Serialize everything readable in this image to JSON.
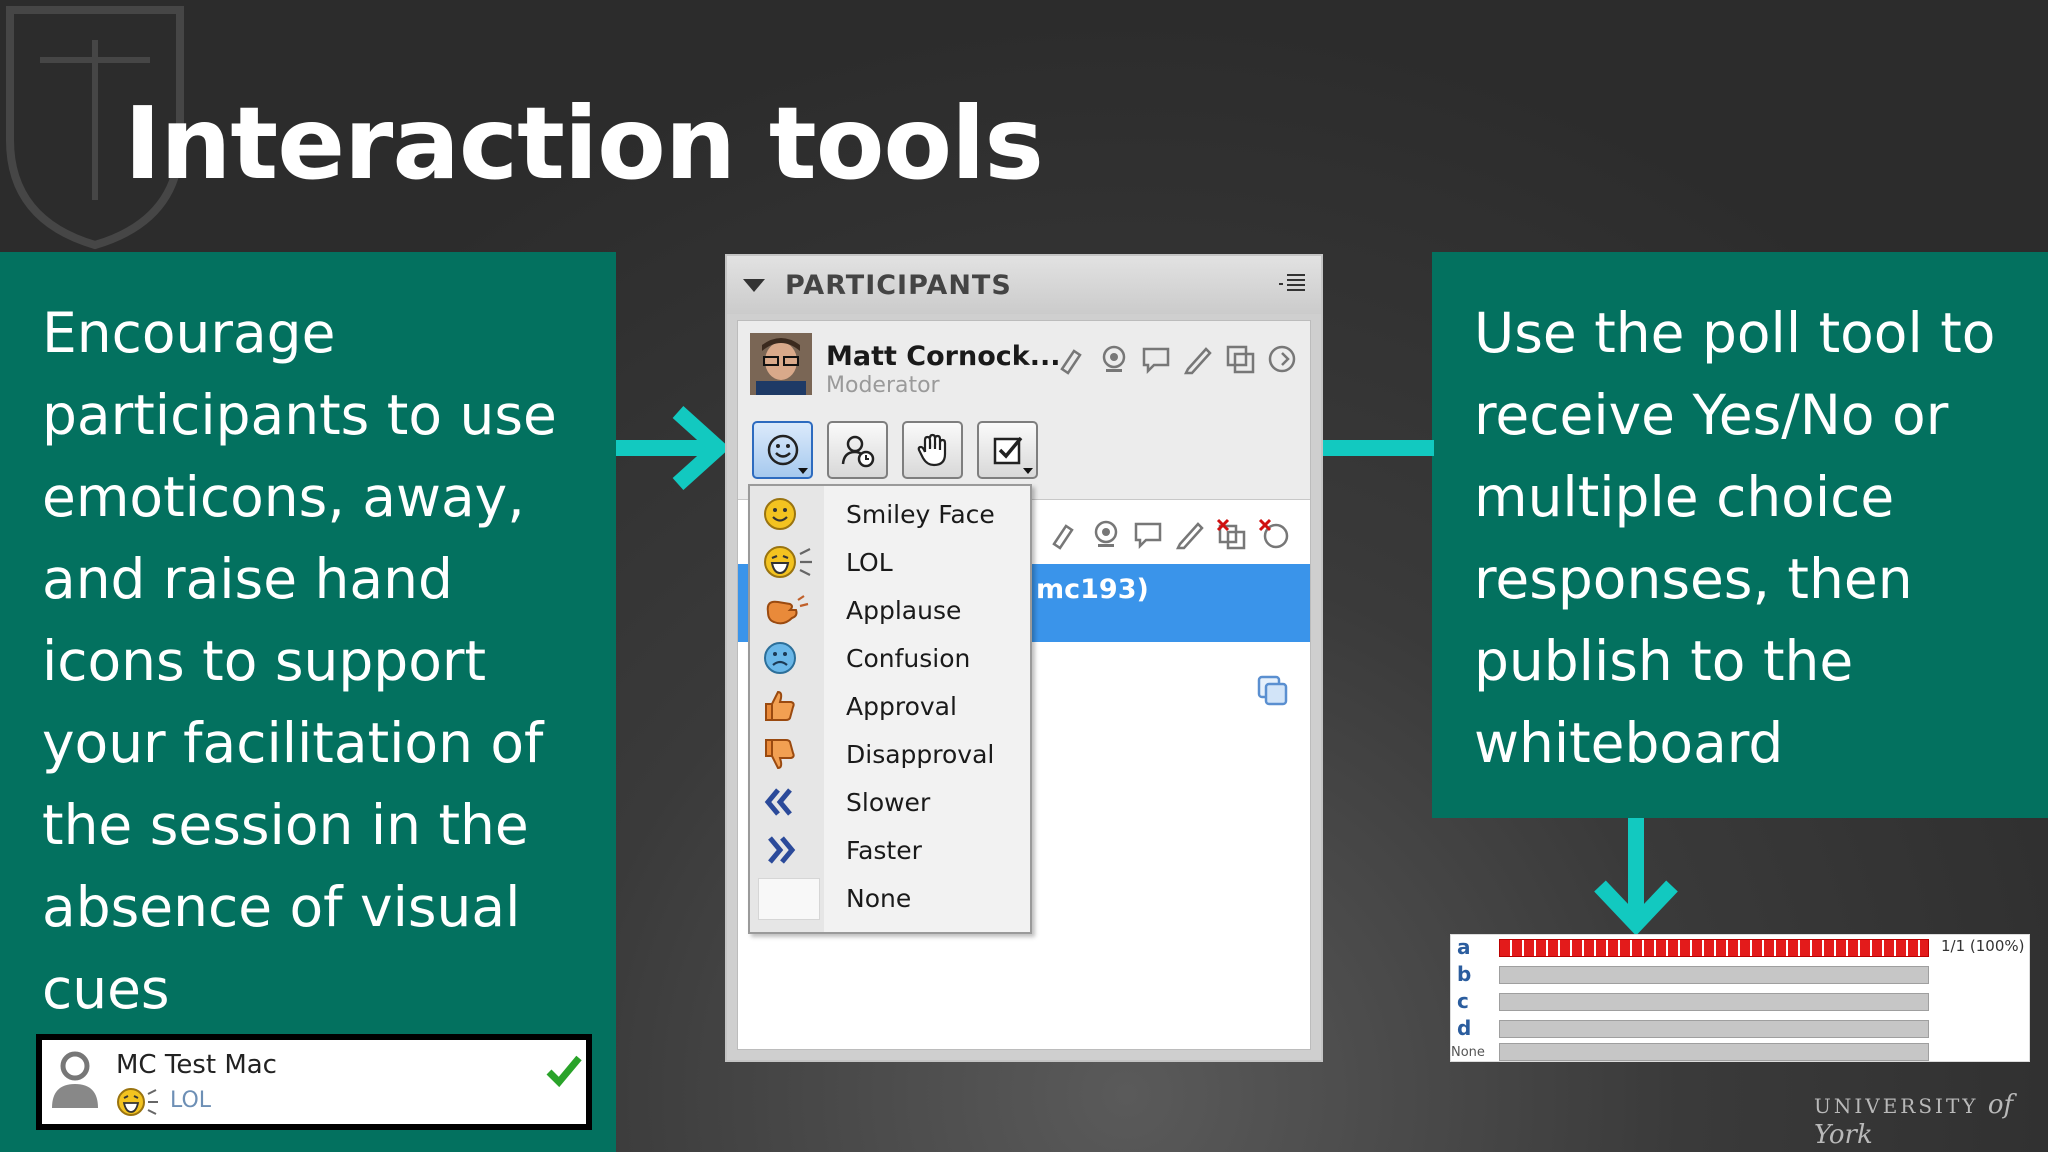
{
  "slide": {
    "title": "Interaction tools"
  },
  "left_panel": {
    "text": "Encourage\nparticipants to use\nemoticons, away,\nand raise hand\nicons to support\nyour facilitation of\nthe session in the\nabsence of visual\ncues"
  },
  "right_panel": {
    "text": "Use the poll tool to\nreceive Yes/No or\nmultiple choice\nresponses, then\npublish to the\nwhiteboard"
  },
  "participants": {
    "header": "PARTICIPANTS",
    "moderator_name": "Matt Cornock...",
    "moderator_role": "Moderator",
    "selected_row_text": "mc193)",
    "tool_buttons": [
      "emoticon-icon",
      "away-icon",
      "raise-hand-icon",
      "poll-icon"
    ]
  },
  "emoticon_menu": {
    "items": [
      {
        "label": "Smiley Face",
        "icon": "smiley-face-icon"
      },
      {
        "label": "LOL",
        "icon": "lol-icon"
      },
      {
        "label": "Applause",
        "icon": "applause-icon"
      },
      {
        "label": "Confusion",
        "icon": "confusion-icon"
      },
      {
        "label": "Approval",
        "icon": "thumbs-up-icon"
      },
      {
        "label": "Disapproval",
        "icon": "thumbs-down-icon"
      },
      {
        "label": "Slower",
        "icon": "slower-icon"
      },
      {
        "label": "Faster",
        "icon": "faster-icon"
      },
      {
        "label": "None",
        "icon": "none-icon"
      }
    ]
  },
  "participant_card": {
    "name": "MC Test Mac",
    "status": "LOL"
  },
  "poll_results": {
    "rows": [
      {
        "label": "a",
        "value": 1.0,
        "result_text": "1/1 (100%)"
      },
      {
        "label": "b",
        "value": 0
      },
      {
        "label": "c",
        "value": 0
      },
      {
        "label": "d",
        "value": 0
      },
      {
        "label": "None",
        "value": 0
      }
    ]
  },
  "footer": {
    "logo_main": "UNIVERSITY",
    "logo_of": "of",
    "logo_city": "York"
  },
  "colors": {
    "accent_teal": "#03715f",
    "arrow_cyan": "#12c9c0",
    "selection_blue": "#3a94ea",
    "poll_red": "#e31b1b"
  }
}
